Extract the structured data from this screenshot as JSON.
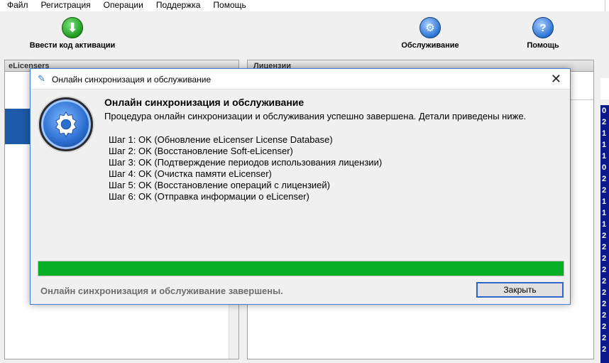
{
  "menu": [
    "Файл",
    "Регистрация",
    "Операции",
    "Поддержка",
    "Помощь"
  ],
  "toolbar": {
    "activate_label": "Ввести код активации",
    "service_label": "Обслуживание",
    "help_label": "Помощь"
  },
  "panes": {
    "left_header": "eLicensers",
    "right_header": "Лицензии",
    "edge_digits": [
      "0",
      "2",
      "1",
      "1",
      "1",
      "0",
      "2",
      "2",
      "1",
      "1",
      "1",
      "2",
      "2",
      "2",
      "2",
      "2",
      "2",
      "2",
      "2",
      "2",
      "2",
      "2"
    ]
  },
  "dialog": {
    "title": "Онлайн синхронизация и обслуживание",
    "heading": "Онлайн синхронизация и обслуживание",
    "description": "Процедура онлайн синхронизации и обслуживания успешно завершена. Детали приведены ниже.",
    "steps": [
      "Шаг 1: OK  (Обновление eLicenser License Database)",
      "Шаг 2: OK  (Восстановление Soft-eLicenser)",
      "Шаг 3: OK  (Подтверждение периодов использования лицензии)",
      "Шаг 4: OK  (Очистка памяти eLicenser)",
      "Шаг 5: OK  (Восстановление операций с лицензией)",
      "Шаг 6: OK  (Отправка информации о eLicenser)"
    ],
    "progress": 1.0,
    "status_text": "Онлайн синхронизация и обслуживание завершены.",
    "close_label": "Закрыть"
  },
  "colors": {
    "progress_fill": "#06b025",
    "dialog_border": "#3c7fd9",
    "accent": "#2f64c4"
  },
  "icons": [
    "download-arrow-icon",
    "gear-icon",
    "help-icon",
    "pencil-icon",
    "close-icon"
  ]
}
